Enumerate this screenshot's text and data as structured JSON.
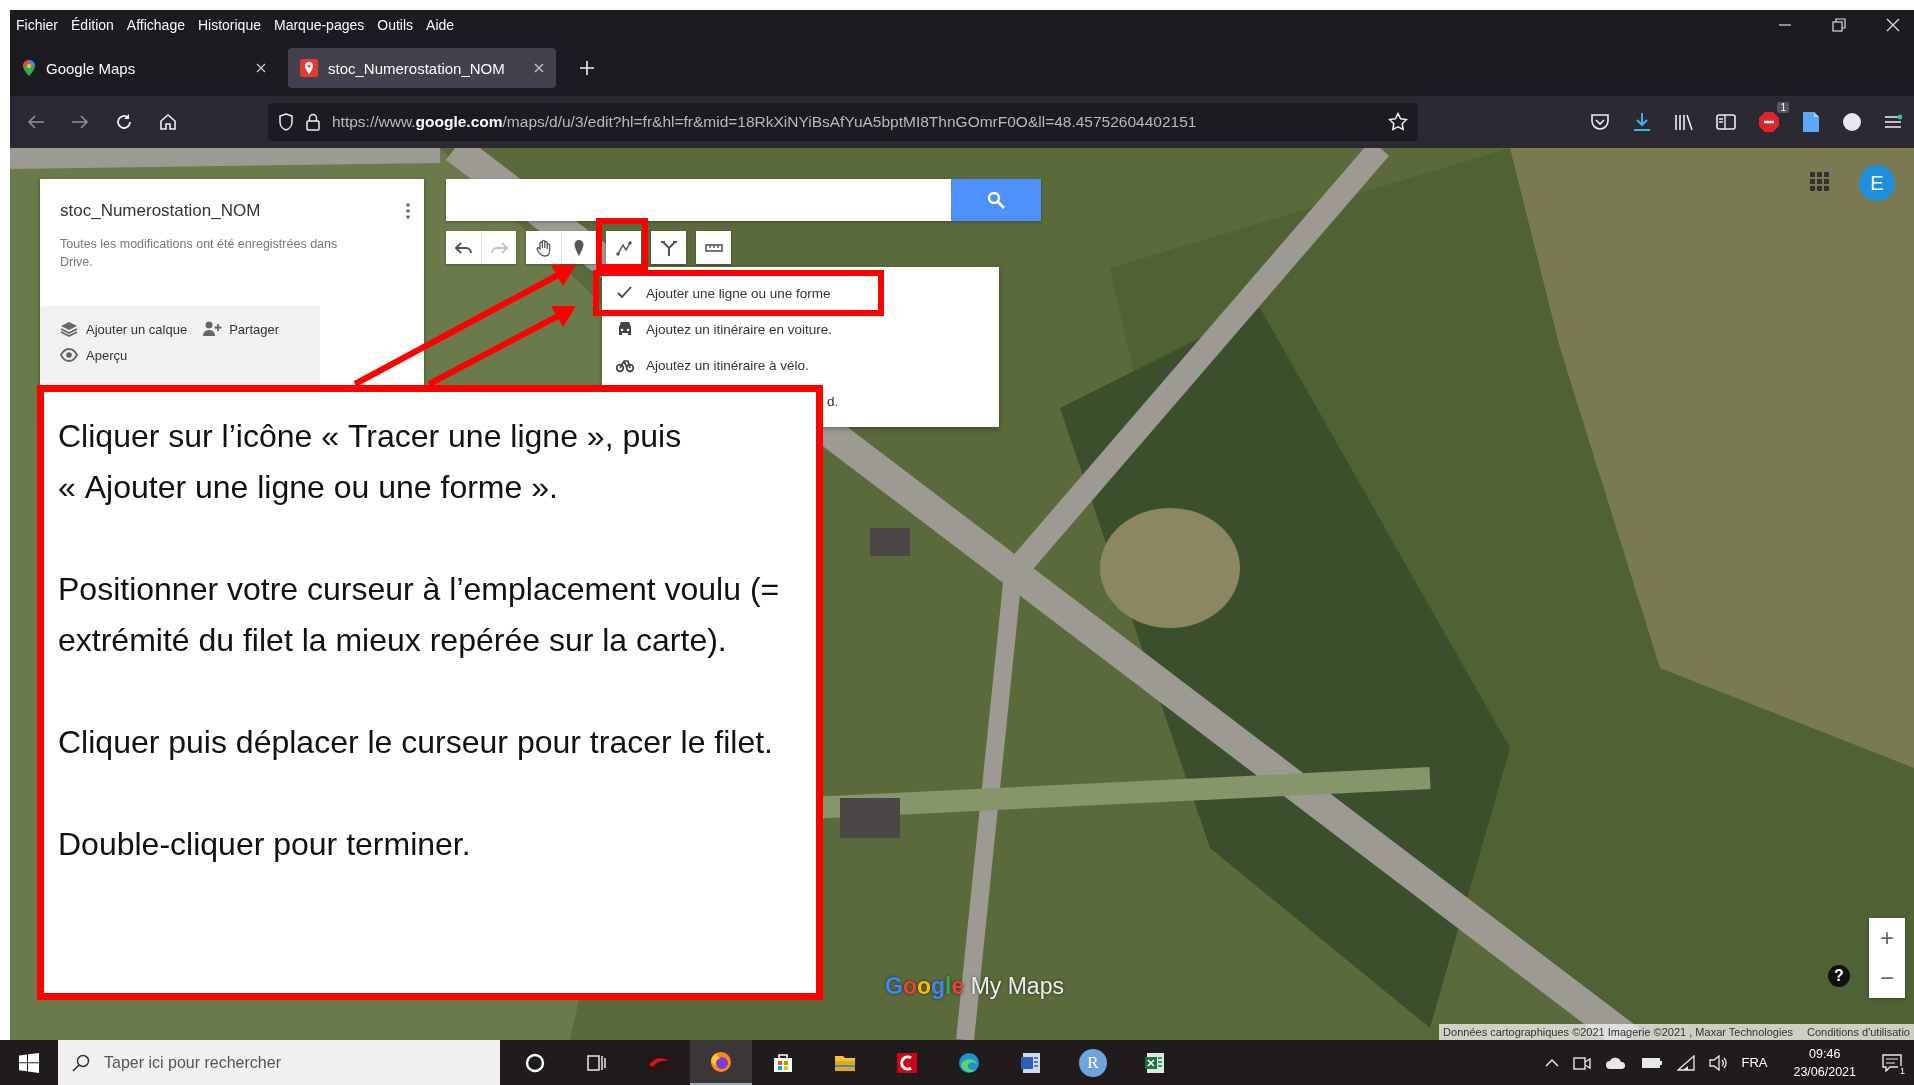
{
  "menu_bar": [
    "Fichier",
    "Édition",
    "Affichage",
    "Historique",
    "Marque-pages",
    "Outils",
    "Aide"
  ],
  "tabs": [
    {
      "label": "Google Maps",
      "selected": false
    },
    {
      "label": "stoc_Numerostation_NOM",
      "selected": true
    }
  ],
  "address_bar": {
    "url": "https://www.**google.com**/maps/d/u/3/edit?hl=fr&hl=fr&mid=18RkXiNYiBsAfYuA5bptMI8ThnGOmrF0O&ll=48.45752604402151"
  },
  "toolbar": {
    "extension_badge": "1"
  },
  "map_panel": {
    "title": "stoc_Numerostation_NOM",
    "status": "Toutes les modifications ont été enregistrées dans Drive.",
    "actions": [
      "Ajouter un calque",
      "Partager",
      "Aperçu"
    ]
  },
  "tool_groups": [
    [
      {
        "kind": "undo",
        "disabled": false
      },
      {
        "kind": "redo",
        "disabled": true
      }
    ],
    [
      {
        "kind": "hand",
        "disabled": false
      },
      {
        "kind": "pin",
        "disabled": false
      }
    ],
    [
      {
        "kind": "line",
        "disabled": false
      }
    ],
    [
      {
        "kind": "route",
        "disabled": false
      }
    ],
    [
      {
        "kind": "ruler",
        "disabled": false
      }
    ]
  ],
  "draw_menu": [
    {
      "kind": "check",
      "label": "Ajouter une ligne ou une forme"
    },
    {
      "kind": "car",
      "label": "Ajoutez un itinéraire en voiture."
    },
    {
      "kind": "bike",
      "label": "Ajoutez un itinéraire à vélo."
    },
    {
      "kind": "covered",
      "label": "d."
    }
  ],
  "profile": {
    "initial": "E"
  },
  "callout": {
    "paragraphs": [
      "Cliquer sur l’icône « Tracer une ligne », puis « Ajouter une ligne ou une forme ».",
      "Positionner votre curseur à l’emplacement voulu (= extrémité du filet la mieux repérée sur la carte).",
      "Cliquer puis déplacer le curseur pour tracer le filet.",
      "Double-cliquer pour terminer."
    ]
  },
  "map": {
    "logo_brand": "Google",
    "logo_product": "My Maps",
    "zoom_in": "+",
    "zoom_out": "−",
    "help": "?",
    "attribution": "Données cartographiques ©2021 Imagerie ©2021 , Maxar Technologies",
    "terms": "Conditions d'utilisatio"
  },
  "taskbar": {
    "search_placeholder": "Taper ici pour rechercher",
    "apps": [
      {
        "kind": "cortana",
        "selected": false
      },
      {
        "kind": "taskview",
        "selected": false
      },
      {
        "kind": "swoosh",
        "selected": false
      },
      {
        "kind": "browser",
        "selected": true
      },
      {
        "kind": "store",
        "selected": false
      },
      {
        "kind": "folder",
        "selected": false
      },
      {
        "kind": "swirl",
        "selected": false
      },
      {
        "kind": "wave",
        "selected": false
      },
      {
        "kind": "document",
        "selected": false
      },
      {
        "kind": "letter",
        "label": "R",
        "selected": false
      },
      {
        "kind": "sheet",
        "selected": false
      }
    ],
    "language": "FRA",
    "time": "09:46",
    "date": "23/06/2021",
    "notification_count": "1"
  }
}
